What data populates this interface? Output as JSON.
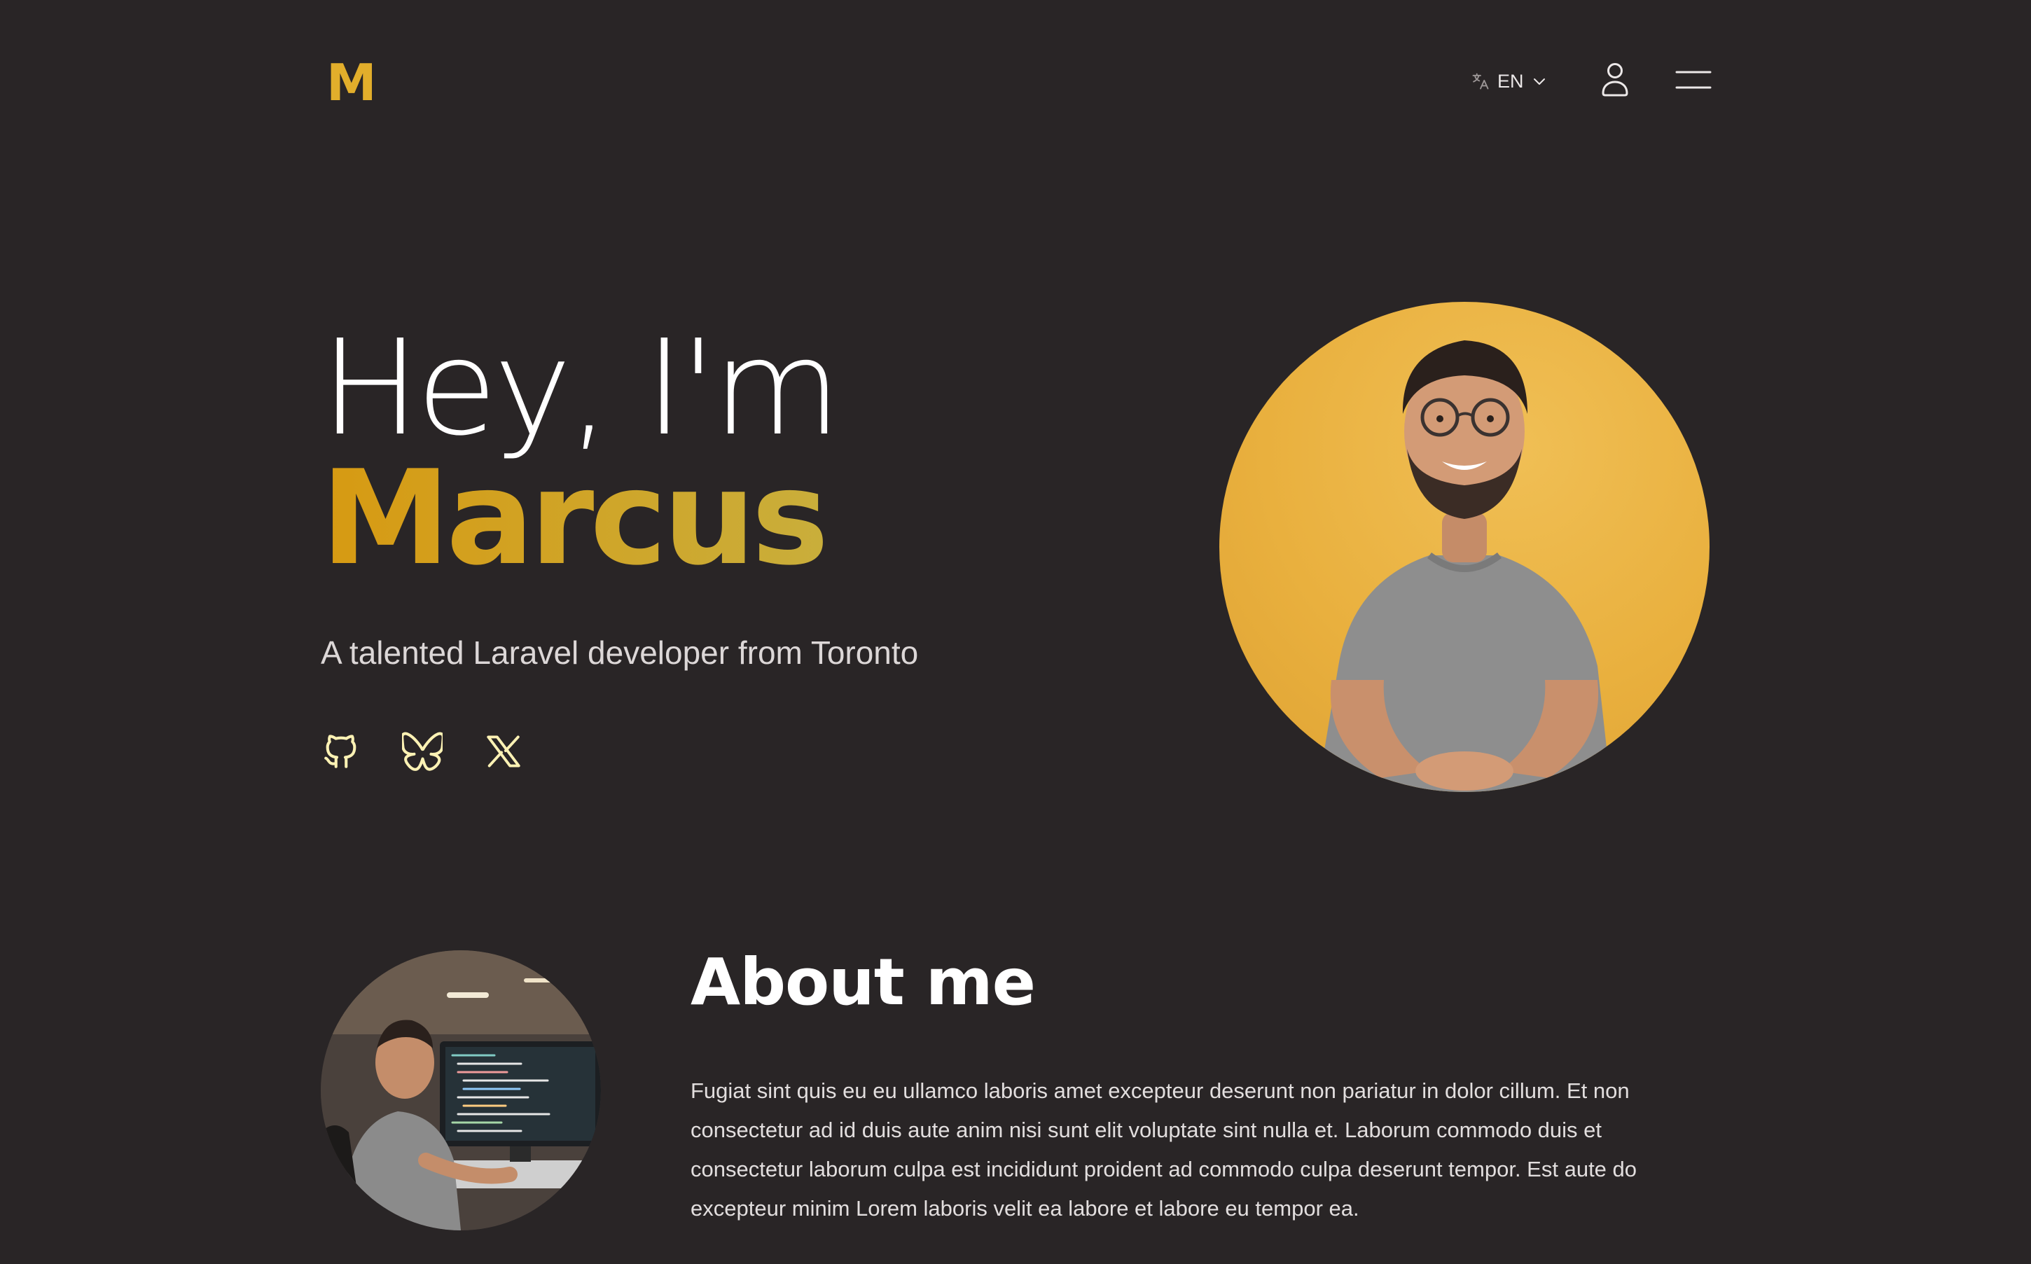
{
  "header": {
    "logo": "M",
    "language": {
      "code": "EN",
      "icon": "translate-icon",
      "chevron": "chevron-down-icon"
    },
    "user_icon": "user-icon",
    "menu_icon": "hamburger-menu-icon"
  },
  "hero": {
    "greeting": "Hey, I'm",
    "name": "Marcus",
    "tagline": "A talented Laravel developer from Toronto",
    "socials": [
      {
        "icon": "github-icon"
      },
      {
        "icon": "bluesky-icon"
      },
      {
        "icon": "x-icon"
      }
    ],
    "portrait": "portrait-photo"
  },
  "about": {
    "photo": "developer-at-desk-photo",
    "title": "About me",
    "body": "Fugiat sint quis eu eu ullamco laboris amet excepteur deserunt non pariatur in dolor cillum. Et non consectetur ad id duis aute anim nisi sunt elit voluptate sint nulla et. Laborum commodo duis et consectetur laborum culpa est incididunt proident ad commodo culpa deserunt tempor. Est aute do excepteur minim Lorem laboris velit ea labore et labore eu tempor ea."
  },
  "colors": {
    "background": "#292526",
    "accent": "#e2ae2b",
    "accent_gradient_start": "#d79a12",
    "accent_gradient_end": "#c9ae3b",
    "social_icon": "#fdf2b4",
    "portrait_bg": "#e9b03e"
  }
}
